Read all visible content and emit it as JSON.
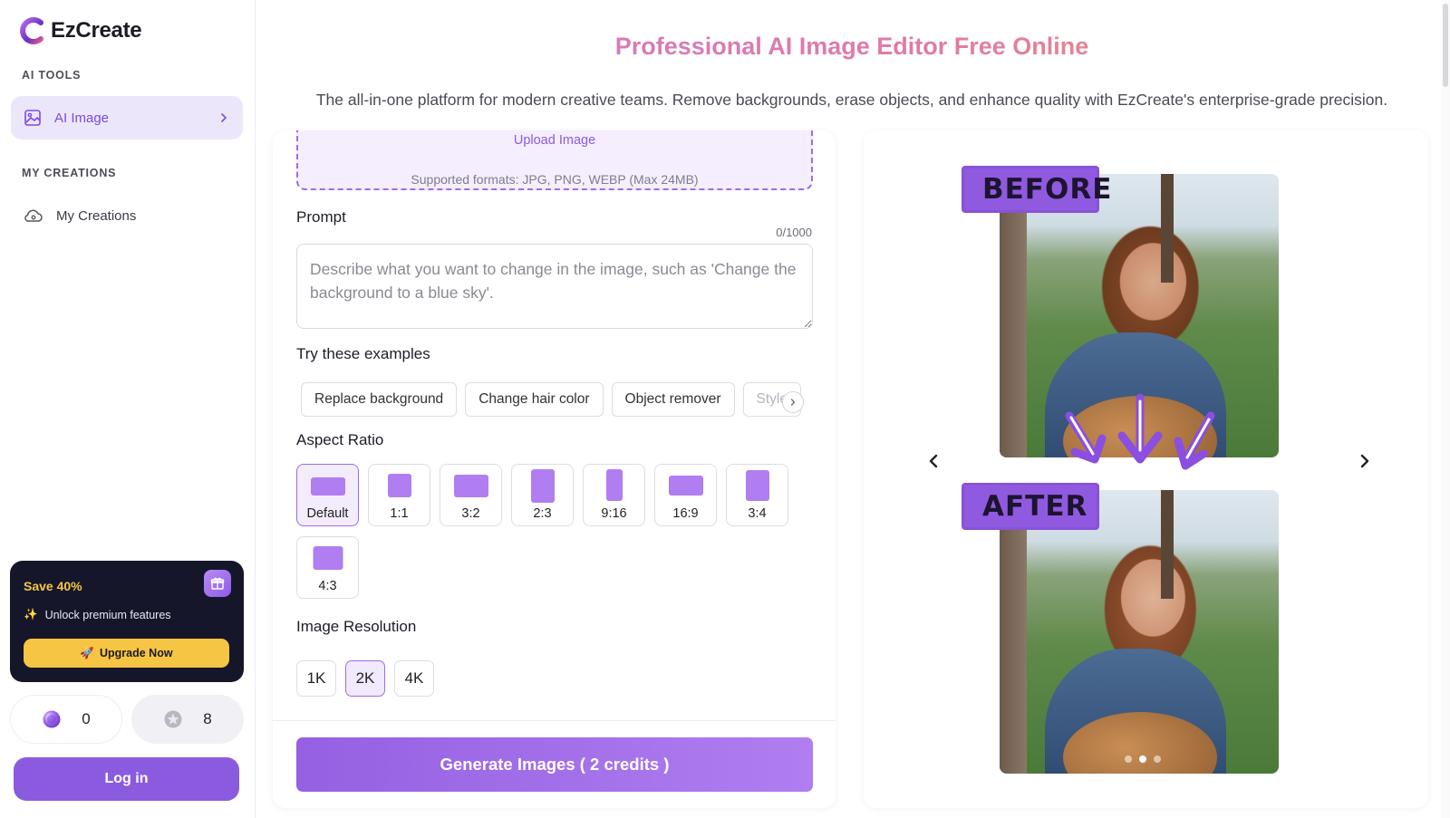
{
  "brand": {
    "name": "EzCreate"
  },
  "sidebar": {
    "section_tools": "AI TOOLS",
    "ai_image": "AI Image",
    "section_creations": "MY CREATIONS",
    "my_creations": "My Creations"
  },
  "promo": {
    "title": "Save 40%",
    "subtitle": "Unlock premium features",
    "button": "Upgrade Now",
    "button_icon": "🚀",
    "sparkle_icon": "✨"
  },
  "credits": {
    "purple": "0",
    "silver": "8"
  },
  "auth": {
    "login": "Log in"
  },
  "header": {
    "title": "Professional AI Image Editor Free Online",
    "subtitle": "The all-in-one platform for modern creative teams. Remove backgrounds, erase objects, and enhance quality with EzCreate's enterprise-grade precision."
  },
  "upload": {
    "link": "Upload Image",
    "formats": "Supported formats: JPG, PNG, WEBP (Max 24MB)"
  },
  "prompt": {
    "label": "Prompt",
    "counter": "0/1000",
    "placeholder": "Describe what you want to change in the image, such as 'Change the background to a blue sky'."
  },
  "examples": {
    "label": "Try these examples",
    "items": [
      "Replace background",
      "Change hair color",
      "Object remover",
      "Style"
    ]
  },
  "aspect": {
    "label": "Aspect Ratio",
    "selected": "Default",
    "options": [
      "Default",
      "1:1",
      "3:2",
      "2:3",
      "9:16",
      "16:9",
      "3:4",
      "4:3"
    ]
  },
  "resolution": {
    "label": "Image Resolution",
    "selected": "2K",
    "options": [
      "1K",
      "2K",
      "4K"
    ]
  },
  "generate": {
    "label": "Generate Images ( 2 credits )"
  },
  "preview": {
    "before": "BEFORE",
    "after": "AFTER",
    "slide_count": 3,
    "active_slide": 2
  },
  "colors": {
    "accent": "#8b5bdf",
    "accent_light": "#f3ecfd",
    "promo_bg": "#16162b",
    "promo_yellow": "#f6c544"
  }
}
